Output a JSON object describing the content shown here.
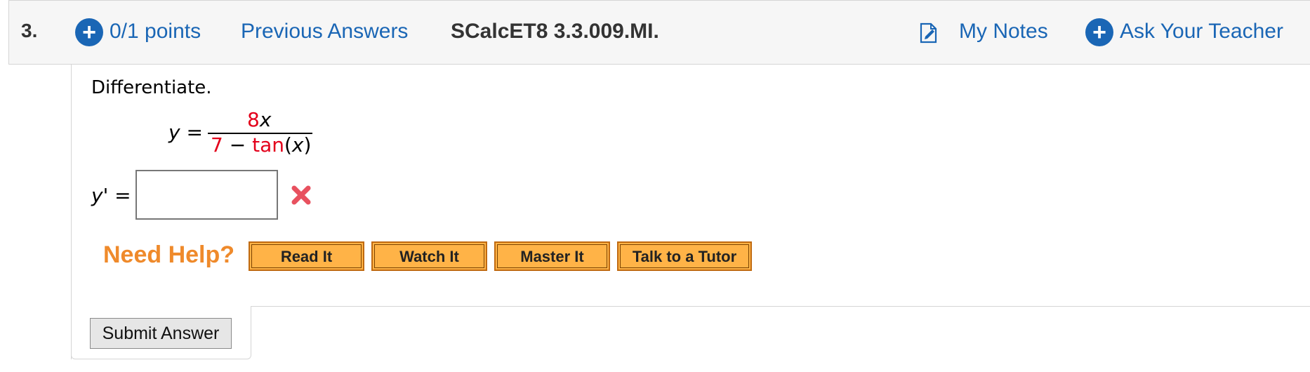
{
  "header": {
    "question_number": "3.",
    "points_label": "0/1 points",
    "previous_answers_label": "Previous Answers",
    "reference_code": "SCalcET8 3.3.009.MI.",
    "my_notes_label": "My Notes",
    "ask_teacher_label": "Ask Your Teacher"
  },
  "problem": {
    "instruction": "Differentiate.",
    "lhs": "y =",
    "numerator_coef": "8",
    "numerator_var": "x",
    "denominator_const": "7",
    "denominator_minus": " − ",
    "denominator_func": "tan",
    "denominator_open": "(",
    "denominator_var": "x",
    "denominator_close": ")"
  },
  "answer": {
    "label_var": "y",
    "label_rest": "' =",
    "value": "",
    "status": "incorrect",
    "status_icon": "red-x-icon"
  },
  "help": {
    "label": "Need Help?",
    "buttons": [
      "Read It",
      "Watch It",
      "Master It",
      "Talk to a Tutor"
    ]
  },
  "submit_label": "Submit Answer",
  "colors": {
    "link_blue": "#1a66b5",
    "highlight_red": "#e3001b",
    "help_orange": "#ef8a2b",
    "button_orange": "#ffb347"
  }
}
